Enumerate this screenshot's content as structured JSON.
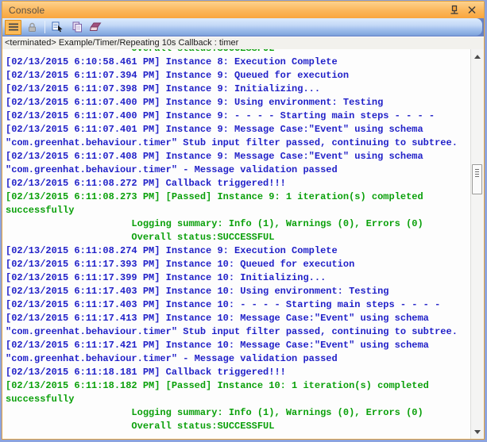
{
  "window": {
    "title": "Console",
    "titlebar_icons": [
      "pin-icon",
      "close-icon"
    ]
  },
  "toolbar": {
    "buttons": [
      {
        "name": "menu-button",
        "icon": "hamburger-icon",
        "selected": true
      },
      {
        "name": "lock-button",
        "icon": "lock-icon",
        "disabled": true
      },
      {
        "name": "follow-output-button",
        "icon": "list-cursor-icon"
      },
      {
        "name": "copy-button",
        "icon": "copy-icon"
      },
      {
        "name": "clear-console-button",
        "icon": "eraser-icon"
      }
    ]
  },
  "status_line": "<terminated> Example/Timer/Repeating 10s Callback : timer",
  "colors": {
    "log_info_blue": "#2121c8",
    "log_pass_green": "#0aa00a",
    "titlebar_orange": "#f9a63d",
    "toolbar_blue": "#87abe0",
    "frame_border_blue": "#8ca3de",
    "frame_border_orange": "#e2a23e"
  },
  "console": {
    "lines": [
      {
        "text": "                      Overall status:SUCCESSFUL",
        "level": "pass"
      },
      {
        "text": "[02/13/2015 6:10:58.461 PM] Instance 8: Execution Complete",
        "level": "info"
      },
      {
        "text": "[02/13/2015 6:11:07.394 PM] Instance 9: Queued for execution",
        "level": "info"
      },
      {
        "text": "[02/13/2015 6:11:07.398 PM] Instance 9: Initializing...",
        "level": "info"
      },
      {
        "text": "[02/13/2015 6:11:07.400 PM] Instance 9: Using environment: Testing",
        "level": "info"
      },
      {
        "text": "[02/13/2015 6:11:07.400 PM] Instance 9: - - - - Starting main steps - - - -",
        "level": "info"
      },
      {
        "text": "[02/13/2015 6:11:07.401 PM] Instance 9: Message Case:\"Event\" using schema",
        "level": "info"
      },
      {
        "text": "\"com.greenhat.behaviour.timer\" Stub input filter passed, continuing to subtree.",
        "level": "info"
      },
      {
        "text": "[02/13/2015 6:11:07.408 PM] Instance 9: Message Case:\"Event\" using schema",
        "level": "info"
      },
      {
        "text": "\"com.greenhat.behaviour.timer\" - Message validation passed",
        "level": "info"
      },
      {
        "text": "[02/13/2015 6:11:08.272 PM] Callback triggered!!!",
        "level": "info"
      },
      {
        "text": "[02/13/2015 6:11:08.273 PM] [Passed] Instance 9: 1 iteration(s) completed",
        "level": "pass"
      },
      {
        "text": "successfully",
        "level": "pass"
      },
      {
        "text": "                      Logging summary: Info (1), Warnings (0), Errors (0)",
        "level": "pass"
      },
      {
        "text": "                      Overall status:SUCCESSFUL",
        "level": "pass"
      },
      {
        "text": "[02/13/2015 6:11:08.274 PM] Instance 9: Execution Complete",
        "level": "info"
      },
      {
        "text": "[02/13/2015 6:11:17.393 PM] Instance 10: Queued for execution",
        "level": "info"
      },
      {
        "text": "[02/13/2015 6:11:17.399 PM] Instance 10: Initializing...",
        "level": "info"
      },
      {
        "text": "[02/13/2015 6:11:17.403 PM] Instance 10: Using environment: Testing",
        "level": "info"
      },
      {
        "text": "[02/13/2015 6:11:17.403 PM] Instance 10: - - - - Starting main steps - - - -",
        "level": "info"
      },
      {
        "text": "[02/13/2015 6:11:17.413 PM] Instance 10: Message Case:\"Event\" using schema",
        "level": "info"
      },
      {
        "text": "\"com.greenhat.behaviour.timer\" Stub input filter passed, continuing to subtree.",
        "level": "info"
      },
      {
        "text": "[02/13/2015 6:11:17.421 PM] Instance 10: Message Case:\"Event\" using schema",
        "level": "info"
      },
      {
        "text": "\"com.greenhat.behaviour.timer\" - Message validation passed",
        "level": "info"
      },
      {
        "text": "[02/13/2015 6:11:18.181 PM] Callback triggered!!!",
        "level": "info"
      },
      {
        "text": "[02/13/2015 6:11:18.182 PM] [Passed] Instance 10: 1 iteration(s) completed",
        "level": "pass"
      },
      {
        "text": "successfully",
        "level": "pass"
      },
      {
        "text": "                      Logging summary: Info (1), Warnings (0), Errors (0)",
        "level": "pass"
      },
      {
        "text": "                      Overall status:SUCCESSFUL",
        "level": "pass"
      }
    ]
  }
}
